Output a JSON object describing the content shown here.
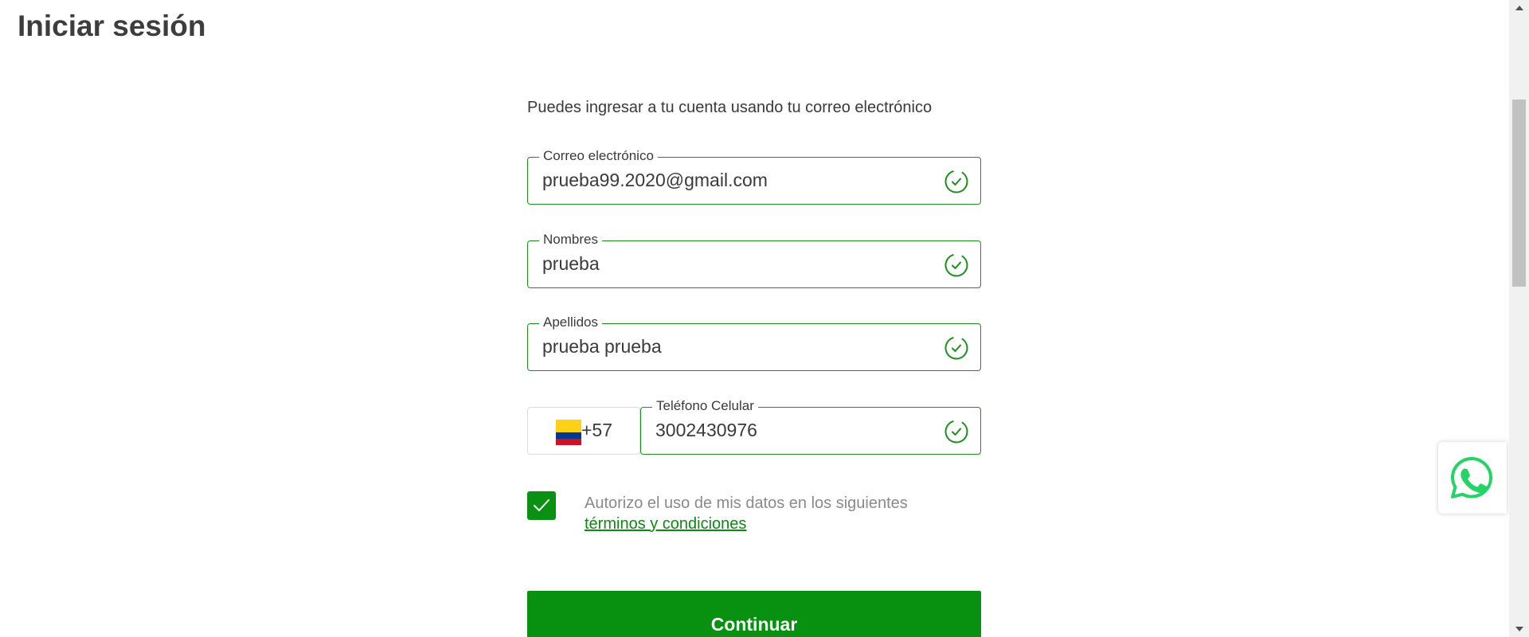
{
  "page": {
    "title": "Iniciar sesión"
  },
  "form": {
    "intro": "Puedes ingresar a tu cuenta usando tu correo electrónico",
    "email": {
      "label": "Correo electrónico",
      "value": "prueba99.2020@gmail.com",
      "status_icon": "check-circle-icon"
    },
    "first_name": {
      "label": "Nombres",
      "value": "prueba",
      "status_icon": "check-circle-icon"
    },
    "last_name": {
      "label": "Apellidos",
      "value": "prueba prueba",
      "status_icon": "check-circle-icon"
    },
    "phone": {
      "country_flag_icon": "colombia-flag-icon",
      "dial_code": "+57",
      "label": "Teléfono Celular",
      "value": "3002430976",
      "status_icon": "check-circle-icon"
    },
    "consent": {
      "checked": true,
      "text": "Autorizo el uso de mis datos en los siguientes",
      "link_text": "términos y condiciones"
    },
    "continue_label": "Continuar"
  },
  "widgets": {
    "whatsapp_icon": "whatsapp-icon"
  },
  "colors": {
    "accent": "#089110",
    "field_border": "#1a8f1a",
    "link": "#0a8a12",
    "text": "#3a3a3a",
    "muted_text": "#8a8a8a"
  }
}
